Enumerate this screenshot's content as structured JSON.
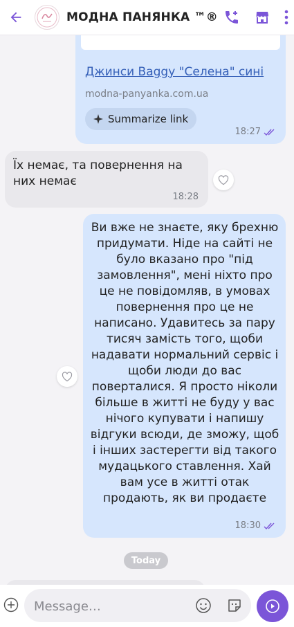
{
  "header": {
    "title": "МОДНА ПАНЯНКА ™®",
    "avatar_text": "Модна панянка"
  },
  "messages": {
    "link_message": {
      "link_title": "Джинси Baggy \"Селена\" сині",
      "domain": "modna-panyanka.com.ua",
      "summarize_label": "Summarize link",
      "time": "18:27"
    },
    "incoming": {
      "text": "Їх немає, та повернення на них немає",
      "time": "18:28"
    },
    "outgoing": {
      "text": "Ви вже не знаєте, яку брехню придумати. Ніде на сайті не було вказано про \"під замовлення\", мені ніхто про це не повідомляв, в умовах повернення про це не написано. Удавитесь за пару тисяч замість того, щоби надавати нормальний сервіс і щоби люди до вас поверталися. Я просто ніколи більше в житті не буду у вас нічого купувати і напишу відгуки всюди, де зможу, щоб і інших застерегти від такого мудацького ставлення. Хай вам усе в житті отак продають, як ви продаєте",
      "time": "18:30"
    }
  },
  "date_divider": "Today",
  "composer": {
    "placeholder": "Message…"
  },
  "colors": {
    "accent": "#7b55d8",
    "outgoing_bubble": "#d6e6fd",
    "incoming_bubble": "#e9e8ec",
    "link": "#3560b8"
  },
  "icons": [
    "back-arrow-icon",
    "add-call-icon",
    "shop-icon",
    "more-icon",
    "heart-icon",
    "sparkle-icon",
    "double-check-icon",
    "plus-icon",
    "emoji-icon",
    "sticker-icon",
    "send-icon"
  ]
}
